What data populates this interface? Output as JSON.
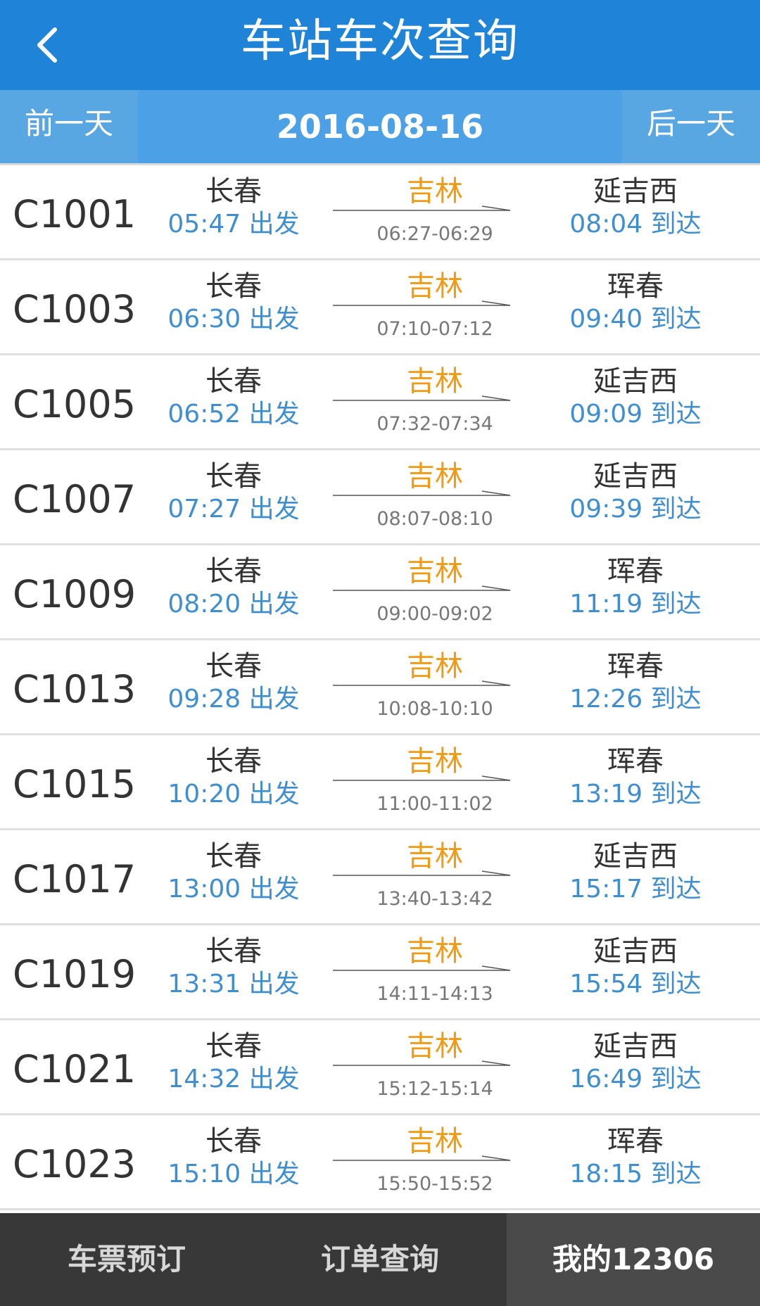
{
  "header": {
    "title": "车站车次查询",
    "back_icon": "chevron-left-icon"
  },
  "datebar": {
    "prev": "前一天",
    "date": "2016-08-16",
    "next": "后一天"
  },
  "trains": [
    {
      "no": "C1001",
      "from": "长春",
      "dep": "05:47 出发",
      "via": "吉林",
      "via_time": "06:27-06:29",
      "to": "延吉西",
      "arr": "08:04 到达"
    },
    {
      "no": "C1003",
      "from": "长春",
      "dep": "06:30 出发",
      "via": "吉林",
      "via_time": "07:10-07:12",
      "to": "珲春",
      "arr": "09:40 到达"
    },
    {
      "no": "C1005",
      "from": "长春",
      "dep": "06:52 出发",
      "via": "吉林",
      "via_time": "07:32-07:34",
      "to": "延吉西",
      "arr": "09:09 到达"
    },
    {
      "no": "C1007",
      "from": "长春",
      "dep": "07:27 出发",
      "via": "吉林",
      "via_time": "08:07-08:10",
      "to": "延吉西",
      "arr": "09:39 到达"
    },
    {
      "no": "C1009",
      "from": "长春",
      "dep": "08:20 出发",
      "via": "吉林",
      "via_time": "09:00-09:02",
      "to": "珲春",
      "arr": "11:19 到达"
    },
    {
      "no": "C1013",
      "from": "长春",
      "dep": "09:28 出发",
      "via": "吉林",
      "via_time": "10:08-10:10",
      "to": "珲春",
      "arr": "12:26 到达"
    },
    {
      "no": "C1015",
      "from": "长春",
      "dep": "10:20 出发",
      "via": "吉林",
      "via_time": "11:00-11:02",
      "to": "珲春",
      "arr": "13:19 到达"
    },
    {
      "no": "C1017",
      "from": "长春",
      "dep": "13:00 出发",
      "via": "吉林",
      "via_time": "13:40-13:42",
      "to": "延吉西",
      "arr": "15:17 到达"
    },
    {
      "no": "C1019",
      "from": "长春",
      "dep": "13:31 出发",
      "via": "吉林",
      "via_time": "14:11-14:13",
      "to": "延吉西",
      "arr": "15:54 到达"
    },
    {
      "no": "C1021",
      "from": "长春",
      "dep": "14:32 出发",
      "via": "吉林",
      "via_time": "15:12-15:14",
      "to": "延吉西",
      "arr": "16:49 到达"
    },
    {
      "no": "C1023",
      "from": "长春",
      "dep": "15:10 出发",
      "via": "吉林",
      "via_time": "15:50-15:52",
      "to": "珲春",
      "arr": "18:15 到达"
    }
  ],
  "tabbar": {
    "tab1": "车票预订",
    "tab2": "订单查询",
    "tab3": "我的12306",
    "active": "我的12306"
  },
  "colors": {
    "header": "#1f84d8",
    "datebar": "#58a6e2",
    "time_blue": "#3f8fd0",
    "via_orange": "#f19a14",
    "tabbar": "#383838"
  }
}
